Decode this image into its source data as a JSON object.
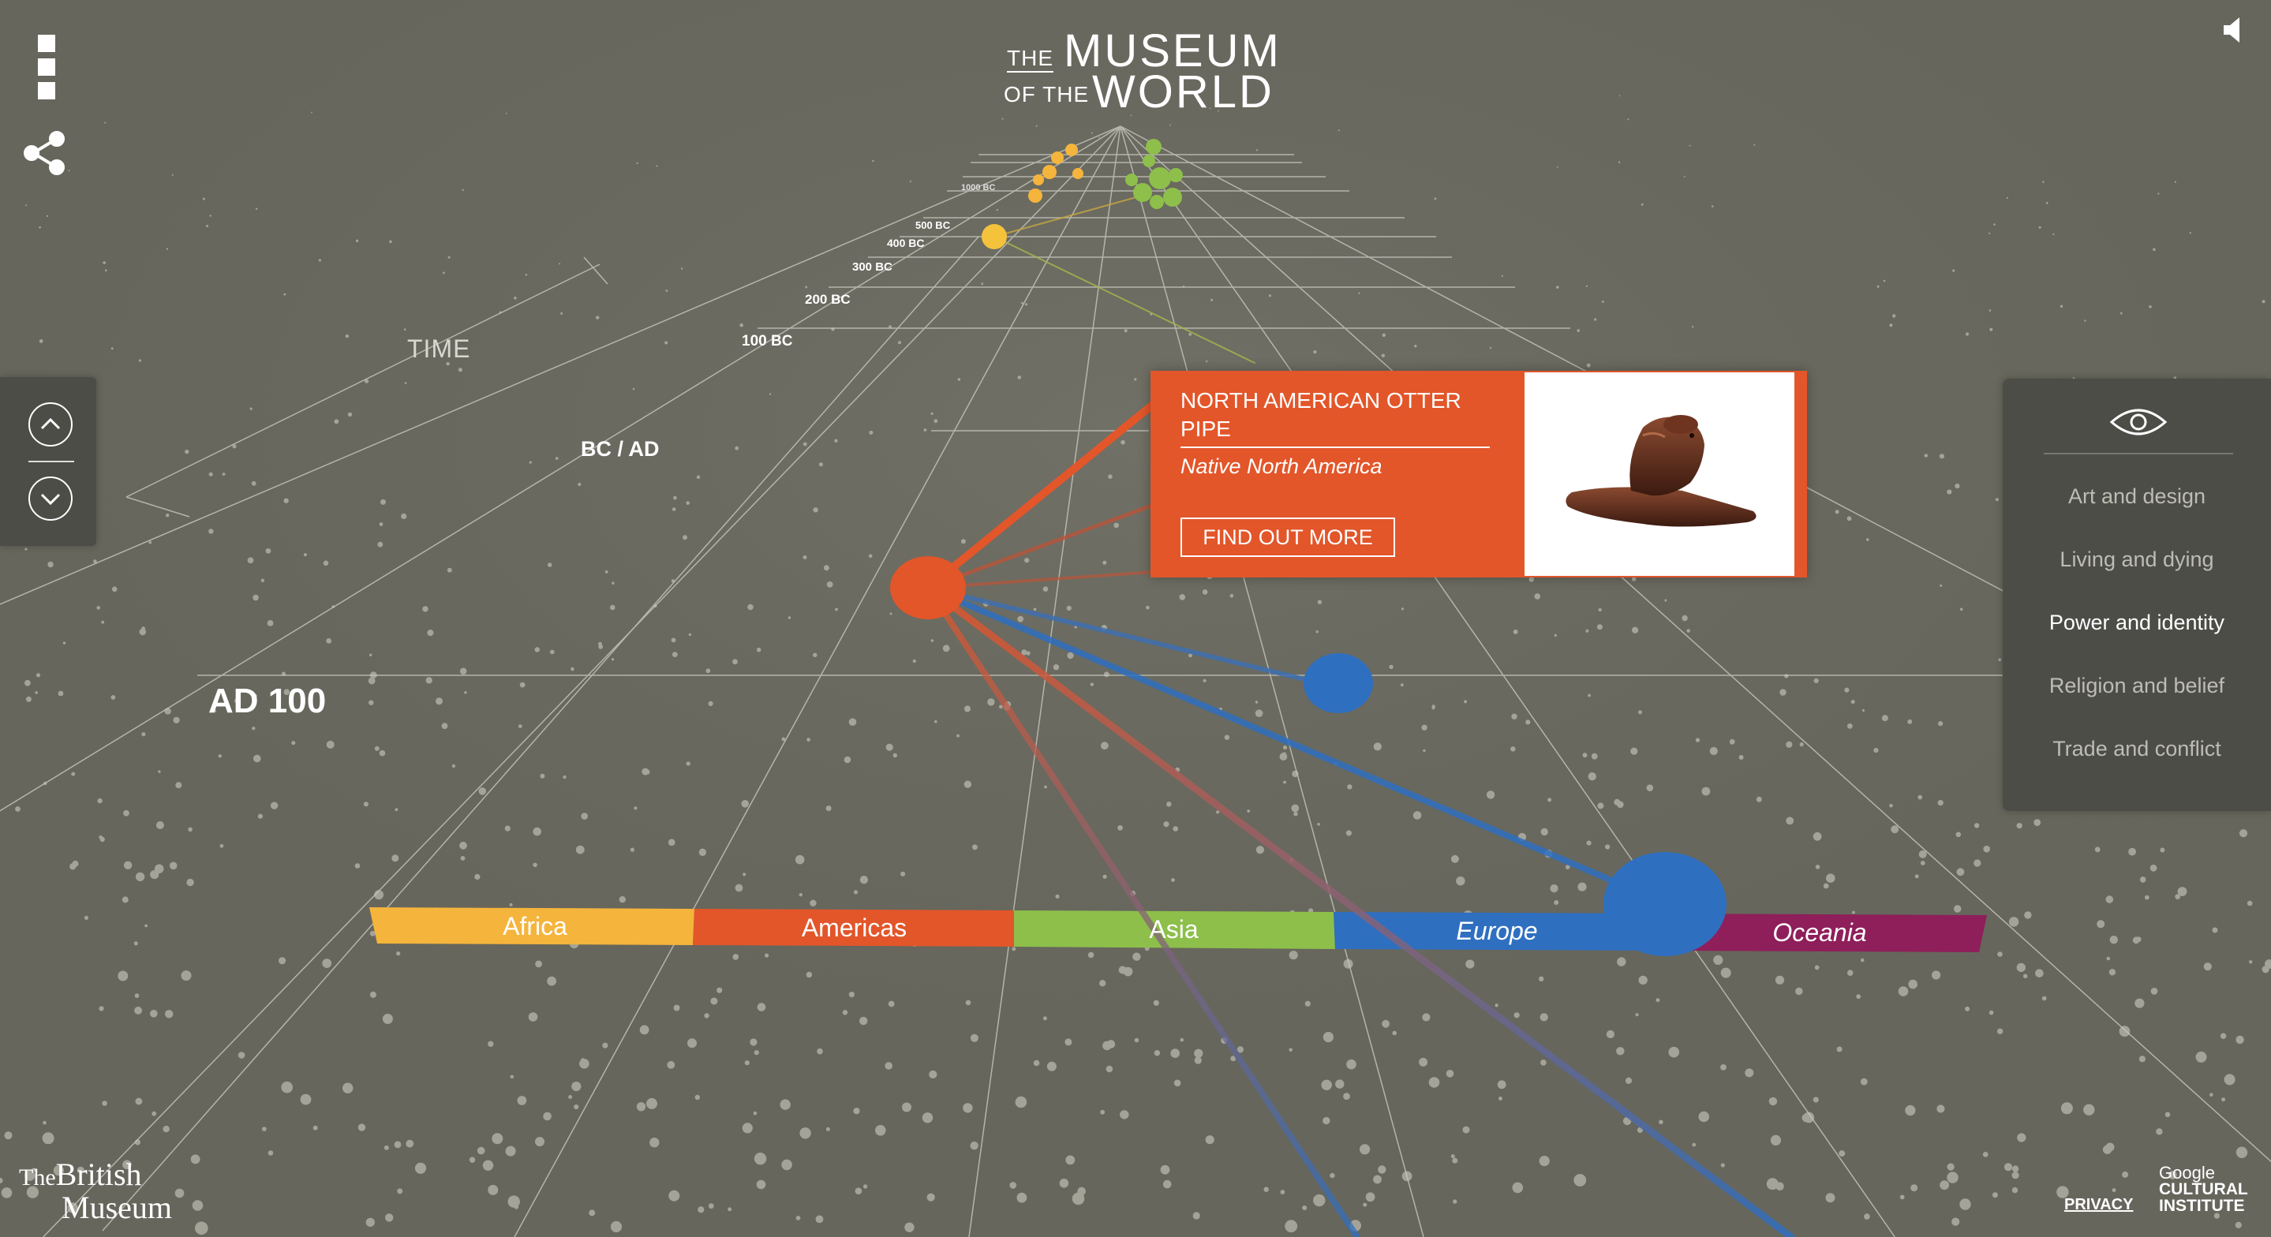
{
  "header": {
    "logo_the": "THE",
    "logo_museum": "MUSEUM",
    "logo_of_the": "OF THE",
    "logo_world": "WORLD"
  },
  "icons": {
    "menu": "menu-icon",
    "share": "share-icon",
    "sound": "speaker-icon",
    "up": "chevron-up-icon",
    "down": "chevron-down-icon",
    "eye": "eye-icon"
  },
  "timeline": {
    "axis_label": "TIME",
    "ticks": [
      "1000 BC",
      "500 BC",
      "400 BC",
      "300 BC",
      "200 BC",
      "100 BC"
    ],
    "bc_ad": "BC / AD",
    "current": "AD 100"
  },
  "regions": [
    {
      "name": "Africa",
      "color": "#f5b43c"
    },
    {
      "name": "Americas",
      "color": "#e2562a"
    },
    {
      "name": "Asia",
      "color": "#8dbf4a"
    },
    {
      "name": "Europe",
      "color": "#2f6fc0"
    },
    {
      "name": "Oceania",
      "color": "#8e1f5a"
    }
  ],
  "card": {
    "title": "NORTH AMERICAN OTTER PIPE",
    "subtitle": "Native North America",
    "button": "FIND OUT MORE"
  },
  "filters": {
    "items": [
      {
        "label": "Art and design",
        "active": false
      },
      {
        "label": "Living and dying",
        "active": false
      },
      {
        "label": "Power and identity",
        "active": true
      },
      {
        "label": "Religion and belief",
        "active": false
      },
      {
        "label": "Trade and conflict",
        "active": false
      }
    ]
  },
  "footer": {
    "bm_the": "The",
    "bm_british": "British",
    "bm_museum": "Museum",
    "privacy": "PRIVACY",
    "google": "Google",
    "cultural": "CULTURAL",
    "institute": "INSTITUTE"
  },
  "colors": {
    "background": "#66665c",
    "panel": "#4d4d48",
    "accent": "#e2562a"
  }
}
